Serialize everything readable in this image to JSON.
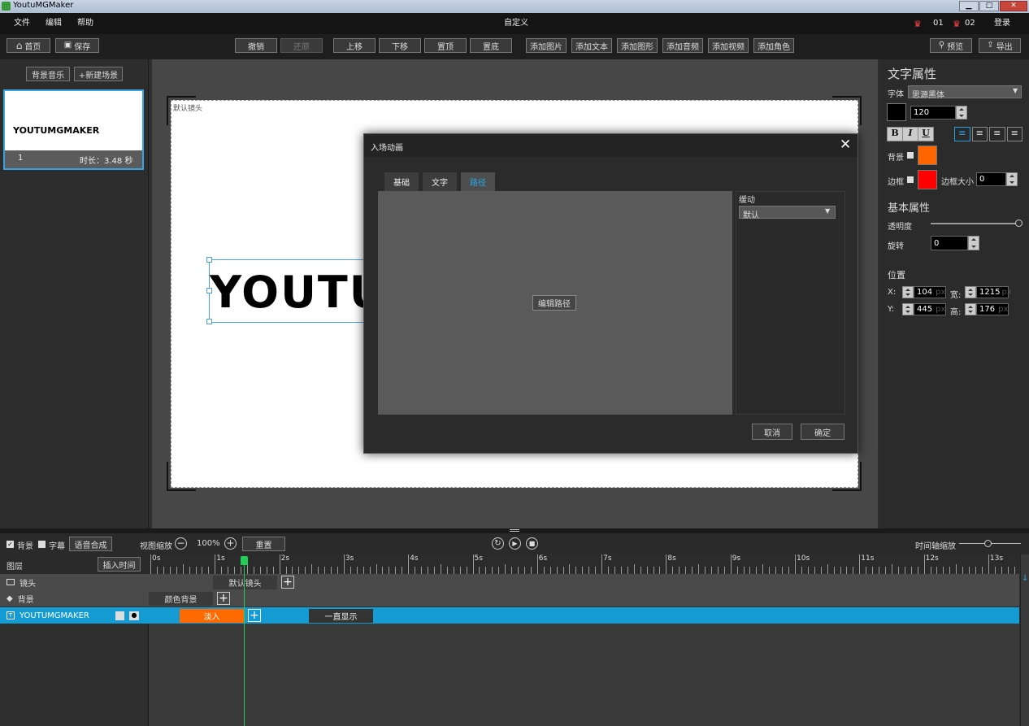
{
  "window": {
    "title": "YoutuMGMaker"
  },
  "menu": {
    "file": "文件",
    "edit": "编辑",
    "help": "帮助",
    "center_title": "自定义",
    "badge1": "01",
    "badge2": "02",
    "login": "登录"
  },
  "toolbar": {
    "home": "首页",
    "save": "保存",
    "undo": "撤销",
    "redo": "还原",
    "up": "上移",
    "down": "下移",
    "top": "置顶",
    "bottom": "置底",
    "add_image": "添加图片",
    "add_text": "添加文本",
    "add_shape": "添加图形",
    "add_audio": "添加音频",
    "add_video": "添加视频",
    "add_role": "添加角色",
    "preview": "预览",
    "export": "导出"
  },
  "left": {
    "bg_music": "背景音乐",
    "new_scene": "+新建场景",
    "scene_title": "YOUTUMGMAKER",
    "scene_index": "1",
    "scene_duration": "时长：3.48 秒"
  },
  "stage": {
    "camera_label": "默认镜头",
    "text": "YOUTU"
  },
  "dialog": {
    "title": "入场动画",
    "tab_basic": "基础",
    "tab_text": "文字",
    "tab_path": "路径",
    "edit_path": "编辑路径",
    "easing_label": "缓动",
    "easing_value": "默认",
    "cancel": "取消",
    "ok": "确定"
  },
  "props": {
    "title": "文字属性",
    "font_label": "字体",
    "font_value": "思源黑体",
    "size": "120",
    "bold": "B",
    "italic": "I",
    "underline": "U",
    "bg_label": "背景",
    "border_label": "边框",
    "border_size_label": "边框大小",
    "border_size": "0",
    "basic_title": "基本属性",
    "opacity_label": "透明度",
    "rotate_label": "旋转",
    "rotate": "0",
    "position_title": "位置",
    "x_label": "X:",
    "x": "104",
    "y_label": "Y:",
    "y": "445",
    "w_label": "宽:",
    "w": "1215",
    "h_label": "高:",
    "h": "176",
    "unit": "px",
    "text_color": "#000000",
    "bg_color": "#ff6600",
    "border_color": "#ff0000",
    "opacity": 1.0
  },
  "timeline": {
    "bg_check": "背景",
    "subtitle_check": "字幕",
    "tts": "语音合成",
    "view_zoom": "视图缩放",
    "zoom": "100%",
    "reset": "重置",
    "axis_zoom": "时间轴缩放",
    "layers": "图层",
    "insert_time": "插入时间",
    "row_camera": "镜头",
    "row_bg": "背景",
    "row_text": "YOUTUMGMAKER",
    "clip_camera": "默认镜头",
    "clip_bg": "颜色背景",
    "clip_in": "淡入",
    "clip_show": "一直显示",
    "ticks": [
      "0s",
      "1s",
      "2s",
      "3s",
      "4s",
      "5s",
      "6s",
      "7s",
      "8s",
      "9s",
      "10s",
      "11s",
      "12s",
      "13s"
    ]
  }
}
